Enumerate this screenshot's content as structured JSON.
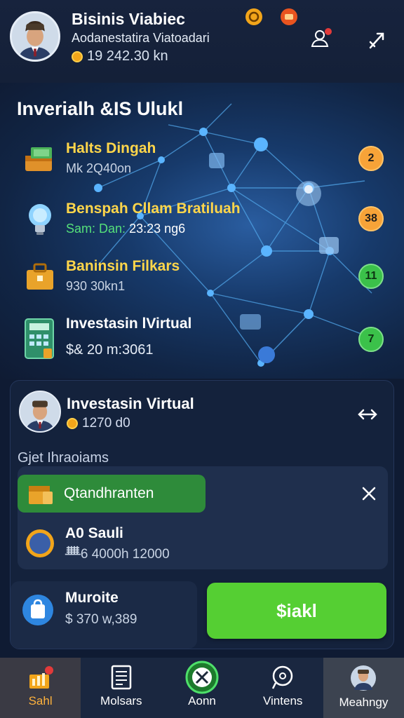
{
  "header": {
    "title": "Bisinis Viabiec",
    "subtitle": "Aodanestatira Viatoadari",
    "balance": "19 242.30 kn"
  },
  "main": {
    "title": "Inverialh &IS Ulukl",
    "features": [
      {
        "title": "Halts Dingah",
        "sub": "Mk 2Q40on",
        "icon": "cash-box-icon",
        "badge": "2",
        "badge_color": "#f7a338"
      },
      {
        "title": "Benspah Cllam Bratiluah",
        "sub_label": "Sam: Dan:",
        "sub_value": "23:23 ng6",
        "icon": "lightbulb-icon",
        "badge": "38",
        "badge_color": "#f7a338"
      },
      {
        "title": "Baninsin Filkars",
        "sub": "930 30kn1",
        "icon": "briefcase-icon",
        "badge": "11",
        "badge_color": "#3bc14a"
      },
      {
        "title": "Investasin lVirtual",
        "sub": "$& 20 m:3061",
        "icon": "calculator-icon",
        "badge": "7",
        "badge_color": "#3bc14a"
      }
    ]
  },
  "card": {
    "title": "Investasin Virtual",
    "balance": "1270 d0",
    "section_label": "Gjet Ihraoiams",
    "pill_label": "Qtandhranten",
    "item_title": "A0 Sauli",
    "item_sub": "ᚙ6 4000h 12000",
    "bottom_title": "Muroite",
    "bottom_sub": "$ 370 w,389",
    "action_label": "$iakl"
  },
  "nav": [
    {
      "label": "Sahl",
      "icon": "chart-bag-icon",
      "active": true
    },
    {
      "label": "Molsars",
      "icon": "document-icon",
      "active": false
    },
    {
      "label": "Aonn",
      "icon": "target-icon",
      "active": false
    },
    {
      "label": "Vintens",
      "icon": "chat-search-icon",
      "active": false
    },
    {
      "label": "Meahngy",
      "icon": "profile-icon",
      "active": false
    }
  ],
  "colors": {
    "accent_yellow": "#ffd64a",
    "accent_green": "#55cf33",
    "background": "#0f1b33"
  }
}
